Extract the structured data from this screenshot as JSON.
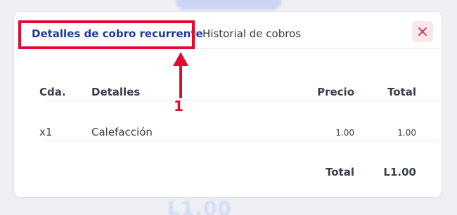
{
  "tabs": [
    {
      "label": "Detalles de cobro recurrente",
      "active": true
    },
    {
      "label": "Historial de cobros",
      "active": false
    }
  ],
  "annotation": {
    "number": "1",
    "color": "#e4072f"
  },
  "table": {
    "columns": [
      "Cda.",
      "Detalles",
      "Precio",
      "Total"
    ],
    "rows": [
      {
        "qty": "x1",
        "details": "Calefacción",
        "price": "1.00",
        "total": "1.00"
      }
    ],
    "footer": {
      "label": "Total",
      "value": "L1.00"
    }
  },
  "background": {
    "amount": "L1.00"
  },
  "colors": {
    "accent": "#1f3d8f",
    "close_bg": "#fbe6ea",
    "close_icon": "#c2344e"
  },
  "icons": {
    "close": "close-icon"
  }
}
